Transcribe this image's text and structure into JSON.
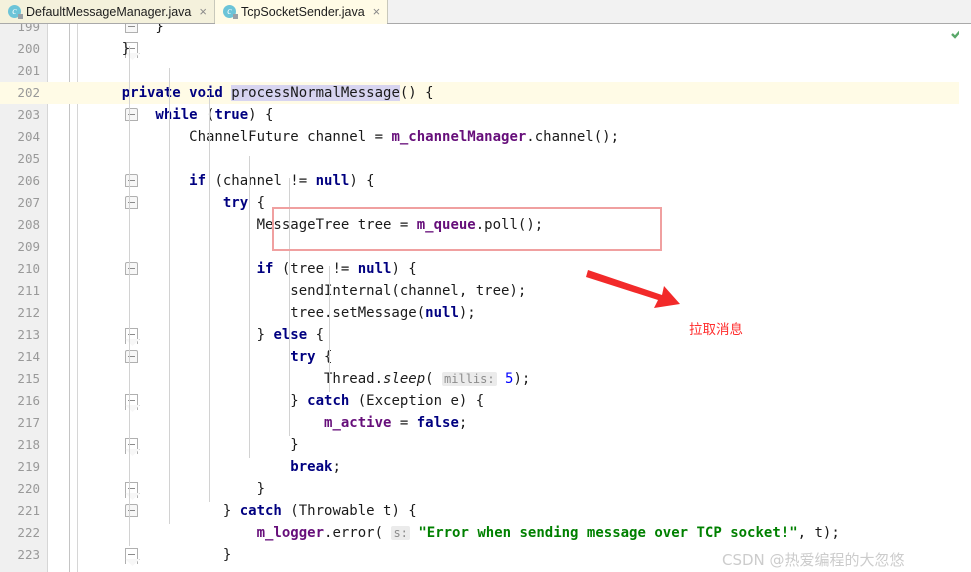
{
  "window": {
    "title": "TcpSocketSender.java",
    "accent_keyword": "#000080",
    "accent_field": "#660e7a",
    "accent_string": "#008000",
    "caret_line_color": "#fffbe6",
    "annotation_color": "#ff2d2d",
    "highlight_box_color": "#f0a0a0"
  },
  "tabs": [
    {
      "label": "DefaultMessageManager.java",
      "icon": "java-class-icon",
      "close": "×",
      "active": false
    },
    {
      "label": "TcpSocketSender.java",
      "icon": "java-class-icon",
      "close": "×",
      "active": true
    }
  ],
  "editor": {
    "first_line": 199,
    "last_line": 223,
    "caret_line": 202,
    "inspection_status": "ok-check-icon",
    "lines": [
      {
        "no": "199",
        "tokens": [
          {
            "t": "plain",
            "v": "        }"
          }
        ]
      },
      {
        "no": "200",
        "tokens": [
          {
            "t": "plain",
            "v": "    }"
          }
        ]
      },
      {
        "no": "201",
        "tokens": [
          {
            "t": "plain",
            "v": ""
          }
        ]
      },
      {
        "no": "202",
        "tokens": [
          {
            "t": "kw",
            "v": "    private void "
          },
          {
            "t": "sel",
            "v": "processNormalMessage"
          },
          {
            "t": "plain",
            "v": "() {"
          }
        ]
      },
      {
        "no": "203",
        "tokens": [
          {
            "t": "kw",
            "v": "        while "
          },
          {
            "t": "plain",
            "v": "("
          },
          {
            "t": "kw",
            "v": "true"
          },
          {
            "t": "plain",
            "v": ") {"
          }
        ]
      },
      {
        "no": "204",
        "tokens": [
          {
            "t": "plain",
            "v": "            ChannelFuture channel = "
          },
          {
            "t": "fld",
            "v": "m_channelManager"
          },
          {
            "t": "plain",
            "v": ".channel();"
          }
        ]
      },
      {
        "no": "205",
        "tokens": [
          {
            "t": "plain",
            "v": ""
          }
        ]
      },
      {
        "no": "206",
        "tokens": [
          {
            "t": "kw",
            "v": "            if "
          },
          {
            "t": "plain",
            "v": "(channel != "
          },
          {
            "t": "kw",
            "v": "null"
          },
          {
            "t": "plain",
            "v": ") {"
          }
        ]
      },
      {
        "no": "207",
        "tokens": [
          {
            "t": "kw",
            "v": "                try "
          },
          {
            "t": "plain",
            "v": "{"
          }
        ]
      },
      {
        "no": "208",
        "tokens": [
          {
            "t": "plain",
            "v": "                    MessageTree tree = "
          },
          {
            "t": "fld",
            "v": "m_queue"
          },
          {
            "t": "plain",
            "v": ".poll();"
          }
        ]
      },
      {
        "no": "209",
        "tokens": [
          {
            "t": "plain",
            "v": ""
          }
        ]
      },
      {
        "no": "210",
        "tokens": [
          {
            "t": "kw",
            "v": "                    if "
          },
          {
            "t": "plain",
            "v": "(tree != "
          },
          {
            "t": "kw",
            "v": "null"
          },
          {
            "t": "plain",
            "v": ") {"
          }
        ]
      },
      {
        "no": "211",
        "tokens": [
          {
            "t": "plain",
            "v": "                        sendInternal(channel, tree);"
          }
        ]
      },
      {
        "no": "212",
        "tokens": [
          {
            "t": "plain",
            "v": "                        tree.setMessage("
          },
          {
            "t": "kw",
            "v": "null"
          },
          {
            "t": "plain",
            "v": ");"
          }
        ]
      },
      {
        "no": "213",
        "tokens": [
          {
            "t": "plain",
            "v": "                    } "
          },
          {
            "t": "kw",
            "v": "else"
          },
          {
            "t": "plain",
            "v": " {"
          }
        ]
      },
      {
        "no": "214",
        "tokens": [
          {
            "t": "kw",
            "v": "                        try "
          },
          {
            "t": "plain",
            "v": "{"
          }
        ]
      },
      {
        "no": "215",
        "tokens": [
          {
            "t": "plain",
            "v": "                            Thread."
          },
          {
            "t": "ital",
            "v": "sleep"
          },
          {
            "t": "plain",
            "v": "( "
          },
          {
            "t": "hint",
            "v": "millis:"
          },
          {
            "t": "plain",
            "v": " "
          },
          {
            "t": "num",
            "v": "5"
          },
          {
            "t": "plain",
            "v": ");"
          }
        ]
      },
      {
        "no": "216",
        "tokens": [
          {
            "t": "plain",
            "v": "                        } "
          },
          {
            "t": "kw",
            "v": "catch"
          },
          {
            "t": "plain",
            "v": " (Exception e) {"
          }
        ]
      },
      {
        "no": "217",
        "tokens": [
          {
            "t": "plain",
            "v": "                            "
          },
          {
            "t": "fld",
            "v": "m_active"
          },
          {
            "t": "plain",
            "v": " = "
          },
          {
            "t": "kw",
            "v": "false"
          },
          {
            "t": "plain",
            "v": ";"
          }
        ]
      },
      {
        "no": "218",
        "tokens": [
          {
            "t": "plain",
            "v": "                        }"
          }
        ]
      },
      {
        "no": "219",
        "tokens": [
          {
            "t": "kw",
            "v": "                        break"
          },
          {
            "t": "plain",
            "v": ";"
          }
        ]
      },
      {
        "no": "220",
        "tokens": [
          {
            "t": "plain",
            "v": "                    }"
          }
        ]
      },
      {
        "no": "221",
        "tokens": [
          {
            "t": "plain",
            "v": "                } "
          },
          {
            "t": "kw",
            "v": "catch"
          },
          {
            "t": "plain",
            "v": " (Throwable t) {"
          }
        ]
      },
      {
        "no": "222",
        "tokens": [
          {
            "t": "plain",
            "v": "                    "
          },
          {
            "t": "fld",
            "v": "m_logger"
          },
          {
            "t": "plain",
            "v": ".error( "
          },
          {
            "t": "hint",
            "v": "s:"
          },
          {
            "t": "str",
            "v": " \"Error when sending message over TCP socket!\""
          },
          {
            "t": "plain",
            "v": ", t);"
          }
        ]
      },
      {
        "no": "223",
        "tokens": [
          {
            "t": "plain",
            "v": "                }"
          }
        ]
      }
    ]
  },
  "annotations": {
    "highlight_box": {
      "target_line": 208,
      "note": "MessageTree tree = m_queue.poll();"
    },
    "callout_label": "拉取消息",
    "arrow": "red-arrow-icon"
  },
  "watermark": {
    "text": "CSDN @热爱编程的大忽悠"
  }
}
